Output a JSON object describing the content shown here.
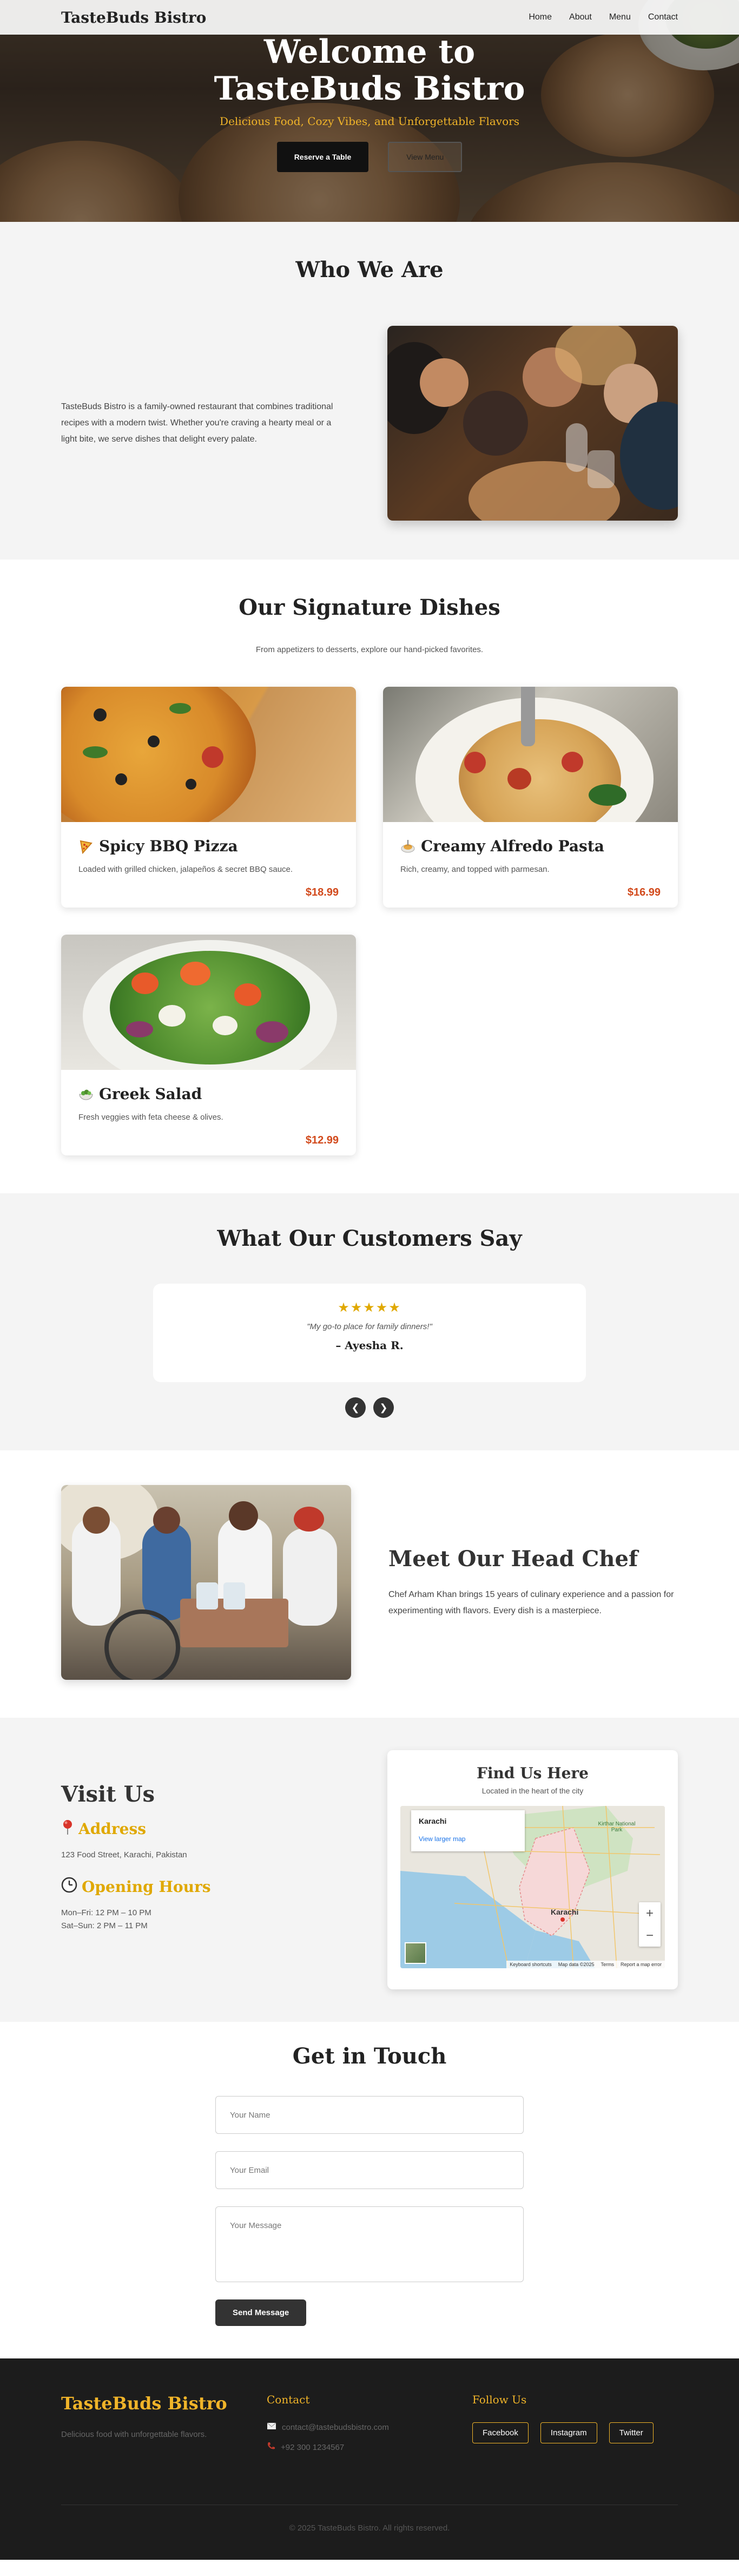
{
  "nav": {
    "brand": "TasteBuds Bistro",
    "links": [
      "Home",
      "About",
      "Menu",
      "Contact"
    ]
  },
  "hero": {
    "title_line1": "Welcome to",
    "title_line2": "TasteBuds Bistro",
    "tagline": "Delicious Food, Cozy Vibes, and Unforgettable Flavors",
    "primary_button": "Reserve a Table",
    "secondary_button": "View Menu"
  },
  "about": {
    "title": "Who We Are",
    "text": "TasteBuds Bistro is a family-owned restaurant that combines traditional recipes with a modern twist. Whether you're craving a hearty meal or a light bite, we serve dishes that delight every palate."
  },
  "dishes": {
    "title": "Our Signature Dishes",
    "subtitle": "From appetizers to desserts, explore our hand-picked favorites.",
    "items": [
      {
        "icon": "pizza-icon",
        "name": "Spicy BBQ Pizza",
        "desc": "Loaded with grilled chicken, jalapeños & secret BBQ sauce.",
        "price": "$18.99"
      },
      {
        "icon": "pasta-icon",
        "name": "Creamy Alfredo Pasta",
        "desc": "Rich, creamy, and topped with parmesan.",
        "price": "$16.99"
      },
      {
        "icon": "salad-icon",
        "name": "Greek Salad",
        "desc": "Fresh veggies with feta cheese & olives.",
        "price": "$12.99"
      }
    ]
  },
  "testimonials": {
    "title": "What Our Customers Say",
    "stars": "★★★★★",
    "rating": 5,
    "quote": "\"My go-to place for family dinners!\"",
    "author": "– Ayesha R.",
    "prev": "❮",
    "next": "❯"
  },
  "chef": {
    "title": "Meet Our Head Chef",
    "text": "Chef Arham Khan brings 15 years of culinary experience and a passion for experimenting with flavors. Every dish is a masterpiece."
  },
  "visit": {
    "title": "Visit Us",
    "address_heading": "Address",
    "address": "123 Food Street, Karachi, Pakistan",
    "hours_heading": "Opening Hours",
    "hours_weekday": "Mon–Fri: 12 PM – 10 PM",
    "hours_weekend": "Sat–Sun: 2 PM – 11 PM"
  },
  "map": {
    "title": "Find Us Here",
    "subtitle": "Located in the heart of the city",
    "place": "Karachi",
    "larger_link": "View larger map",
    "city_label": "Karachi",
    "park_label": "Kirthar National Park",
    "footer_items": [
      "Keyboard shortcuts",
      "Map data ©2025",
      "Terms",
      "Report a map error"
    ],
    "zoom_in": "+",
    "zoom_out": "−"
  },
  "contact": {
    "title": "Get in Touch",
    "name_placeholder": "Your Name",
    "email_placeholder": "Your Email",
    "message_placeholder": "Your Message",
    "submit": "Send Message"
  },
  "footer": {
    "brand": "TasteBuds Bistro",
    "tagline": "Delicious food with unforgettable flavors.",
    "contact_heading": "Contact",
    "email": "contact@tastebudsbistro.com",
    "phone": "+92 300 1234567",
    "follow_heading": "Follow Us",
    "socials": [
      "Facebook",
      "Instagram",
      "Twitter"
    ],
    "copyright": "© 2025 TasteBuds Bistro. All rights reserved."
  },
  "colors": {
    "accent": "#f0b429",
    "price": "#d24a1c",
    "footer_bg": "#1c1c1c"
  }
}
